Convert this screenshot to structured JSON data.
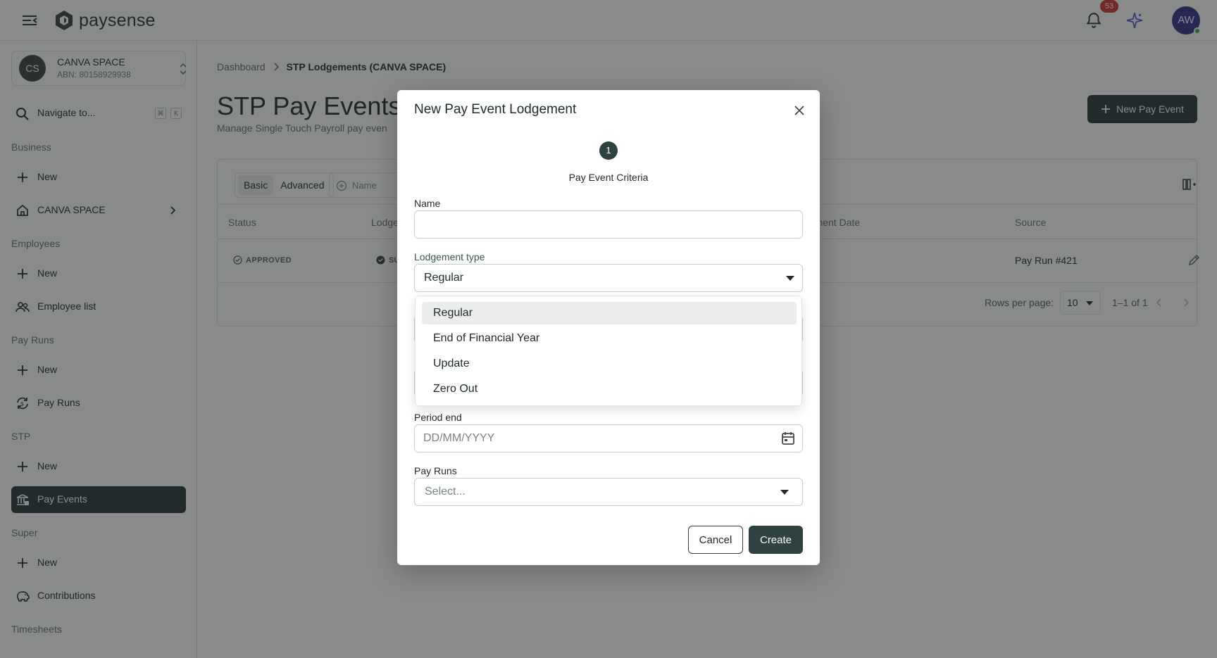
{
  "app": {
    "brand": "paysense",
    "notifications_count": "53",
    "user_initials": "AW"
  },
  "sidebar": {
    "org": {
      "initials": "CS",
      "name": "CANVA SPACE",
      "abn": "ABN: 80158929938"
    },
    "navigate": {
      "label": "Navigate to...",
      "shortcut_1": "⌘",
      "shortcut_2": "K"
    },
    "sections": [
      {
        "label": "Business",
        "items": [
          {
            "label": "New",
            "icon": "plus-icon"
          },
          {
            "label": "CANVA SPACE",
            "icon": "home-icon"
          }
        ]
      },
      {
        "label": "Employees",
        "items": [
          {
            "label": "New",
            "icon": "plus-icon"
          },
          {
            "label": "Employee list",
            "icon": "users-icon"
          }
        ]
      },
      {
        "label": "Pay Runs",
        "items": [
          {
            "label": "New",
            "icon": "plus-icon"
          },
          {
            "label": "Pay Runs",
            "icon": "refresh-money-icon"
          }
        ]
      },
      {
        "label": "STP",
        "items": [
          {
            "label": "New",
            "icon": "plus-icon"
          },
          {
            "label": "Pay Events",
            "icon": "bank-icon",
            "active": true
          }
        ]
      },
      {
        "label": "Super",
        "items": [
          {
            "label": "New",
            "icon": "plus-icon"
          },
          {
            "label": "Contributions",
            "icon": "piggy-bank-icon"
          }
        ]
      },
      {
        "label": "Timesheets",
        "items": []
      }
    ]
  },
  "main": {
    "breadcrumb": {
      "root": "Dashboard",
      "current": "STP Lodgements (CANVA SPACE)"
    },
    "title": "STP Pay Events",
    "subtitle": "Manage Single Touch Payroll pay even",
    "new_button": "New Pay Event",
    "toggle": {
      "basic": "Basic",
      "advanced": "Advanced"
    },
    "filter_placeholder": "Name",
    "columns": {
      "status": "Status",
      "lodgement": "Lodge",
      "lodgement_date": "gement Date",
      "source": "Source"
    },
    "row": {
      "status": "APPROVED",
      "lodgement_status": "SU",
      "source": "Pay Run #421"
    },
    "pagination": {
      "rows_label": "Rows per page:",
      "rows_value": "10",
      "range": "1–1 of 1"
    }
  },
  "modal": {
    "title": "New Pay Event Lodgement",
    "step_number": "1",
    "step_label": "Pay Event Criteria",
    "name_label": "Name",
    "name_value": "",
    "lodgement_type_label": "Lodgement type",
    "lodgement_type_value": "Regular",
    "period_end_label": "Period end",
    "period_end_placeholder": "DD/MM/YYYY",
    "pay_runs_label": "Pay Runs",
    "pay_runs_placeholder": "Select...",
    "cancel_label": "Cancel",
    "create_label": "Create"
  },
  "dropdown": {
    "options": [
      "Regular",
      "End of Financial Year",
      "Update",
      "Zero Out"
    ],
    "selected_index": 0
  },
  "colors": {
    "primary": "#2f4140",
    "badge": "#d13d3d",
    "avatar": "#3b3a8f"
  }
}
